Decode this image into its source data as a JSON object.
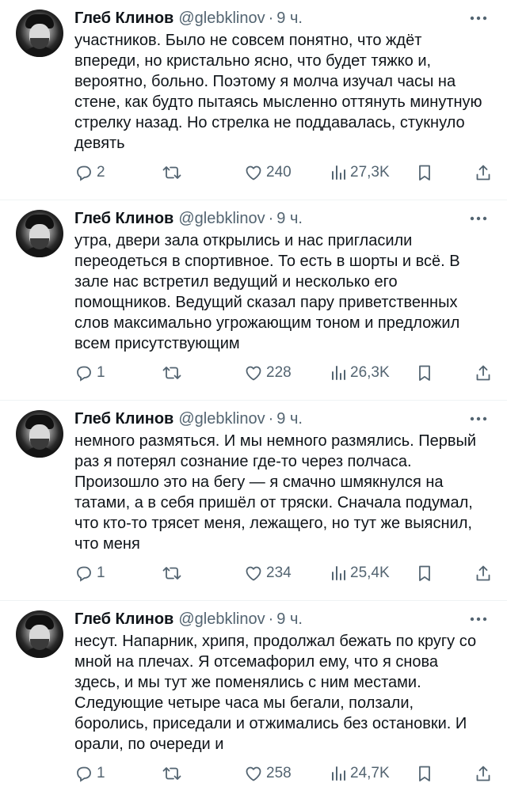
{
  "tweets": [
    {
      "author": {
        "name": "Глеб Клинов",
        "handle": "@glebklinov",
        "dot": "·",
        "time": "9 ч."
      },
      "text": "участников. Было не совсем понятно, что ждёт впереди, но кристально ясно, что будет тяжко и, вероятно, больно. Поэтому я молча изучал часы на стене, как будто пытаясь мысленно оттянуть минутную стрелку назад. Но стрелка не поддавалась, стукнуло девять",
      "replies": "2",
      "retweets": "",
      "likes": "240",
      "views": "27,3K"
    },
    {
      "author": {
        "name": "Глеб Клинов",
        "handle": "@glebklinov",
        "dot": "·",
        "time": "9 ч."
      },
      "text": "утра, двери зала открылись и нас пригласили переодеться в спортивное. То есть в шорты и всё. В зале нас встретил ведущий и несколько его помощников. Ведущий сказал пару приветственных слов максимально угрожающим тоном и предложил всем присутствующим",
      "replies": "1",
      "retweets": "",
      "likes": "228",
      "views": "26,3K"
    },
    {
      "author": {
        "name": "Глеб Клинов",
        "handle": "@glebklinov",
        "dot": "·",
        "time": "9 ч."
      },
      "text": "немного размяться. И мы немного размялись. Первый раз я потерял сознание где-то через полчаса. Произошло это на бегу — я смачно шмякнулся на татами, а в себя пришёл от тряски. Сначала подумал, что кто-то трясет меня, лежащего, но тут же выяснил, что меня",
      "replies": "1",
      "retweets": "",
      "likes": "234",
      "views": "25,4K"
    },
    {
      "author": {
        "name": "Глеб Клинов",
        "handle": "@glebklinov",
        "dot": "·",
        "time": "9 ч."
      },
      "text": "несут. Напарник, хрипя, продолжал бежать по кругу со мной на плечах. Я отсемафорил ему, что я снова здесь, и мы тут же поменялись с ним местами. Следующие четыре часа мы бегали, ползали, боролись, приседали и отжимались без остановки. И орали, по очереди и",
      "replies": "1",
      "retweets": "",
      "likes": "258",
      "views": "24,7K"
    }
  ],
  "icons": {
    "more": "more-icon",
    "reply": "reply-icon",
    "retweet": "retweet-icon",
    "like": "like-icon",
    "views": "views-icon",
    "bookmark": "bookmark-icon",
    "share": "share-icon"
  },
  "colors": {
    "text": "#0f1419",
    "muted": "#536471",
    "divider": "#eff3f4"
  }
}
